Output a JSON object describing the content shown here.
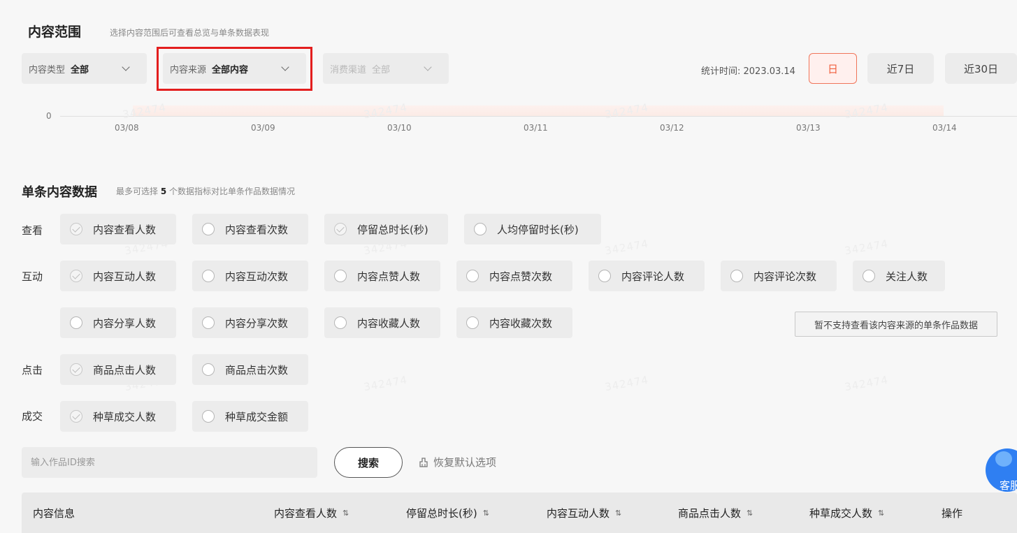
{
  "header": {
    "title": "内容范围",
    "subtitle": "选择内容范围后可查看总览与单条数据表现"
  },
  "filters": [
    {
      "label": "内容类型",
      "value": "全部"
    },
    {
      "label": "内容来源",
      "value": "全部内容"
    },
    {
      "label": "消费渠道",
      "value": "全部"
    }
  ],
  "stats": {
    "time_label": "统计时间: 2023.03.14",
    "periods": [
      "日",
      "近7日",
      "近30日"
    ],
    "active_period": "日"
  },
  "chart": {
    "y_zero": "0",
    "x_ticks": [
      "03/08",
      "03/09",
      "03/10",
      "03/11",
      "03/12",
      "03/13",
      "03/14"
    ]
  },
  "watermark": "342474",
  "single": {
    "title": "单条内容数据",
    "subtitle_pre": "最多可选择",
    "subtitle_num": "5",
    "subtitle_post": "个数据指标对比单条作品数据情况"
  },
  "metrics": {
    "view": {
      "label": "查看",
      "items": [
        {
          "label": "内容查看人数",
          "checked": true
        },
        {
          "label": "内容查看次数",
          "checked": false
        },
        {
          "label": "停留总时长(秒)",
          "checked": true
        },
        {
          "label": "人均停留时长(秒)",
          "checked": false
        }
      ]
    },
    "interact": {
      "label": "互动",
      "row1": [
        {
          "label": "内容互动人数",
          "checked": true
        },
        {
          "label": "内容互动次数",
          "checked": false
        },
        {
          "label": "内容点赞人数",
          "checked": false
        },
        {
          "label": "内容点赞次数",
          "checked": false
        },
        {
          "label": "内容评论人数",
          "checked": false
        },
        {
          "label": "内容评论次数",
          "checked": false
        },
        {
          "label": "关注人数",
          "checked": false
        }
      ],
      "row2": [
        {
          "label": "内容分享人数",
          "checked": false
        },
        {
          "label": "内容分享次数",
          "checked": false
        },
        {
          "label": "内容收藏人数",
          "checked": false
        },
        {
          "label": "内容收藏次数",
          "checked": false
        }
      ]
    },
    "click": {
      "label": "点击",
      "items": [
        {
          "label": "商品点击人数",
          "checked": true
        },
        {
          "label": "商品点击次数",
          "checked": false
        }
      ]
    },
    "deal": {
      "label": "成交",
      "items": [
        {
          "label": "种草成交人数",
          "checked": true
        },
        {
          "label": "种草成交金额",
          "checked": false
        }
      ]
    }
  },
  "notice": "暂不支持查看该内容来源的单条作品数据",
  "search": {
    "placeholder": "输入作品ID搜索",
    "button": "搜索",
    "reset": "恢复默认选项"
  },
  "table": {
    "headers": [
      "内容信息",
      "内容查看人数",
      "停留总时长(秒)",
      "内容互动人数",
      "商品点击人数",
      "种草成交人数",
      "操作"
    ],
    "sort_icon": "⇅"
  },
  "kefu": {
    "label": "客服"
  },
  "colors": {
    "accent": "#f0603e",
    "highlight": "#e31e1e",
    "kefu": "#2f7ff2"
  }
}
